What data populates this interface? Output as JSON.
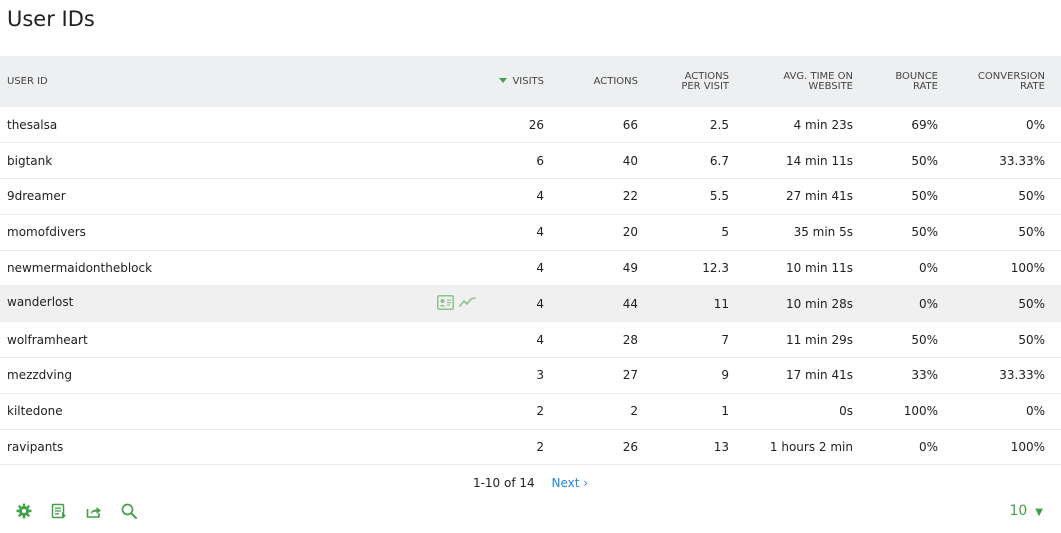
{
  "page": {
    "title": "User IDs"
  },
  "table": {
    "columns": {
      "user_id": "USER ID",
      "visits": "VISITS",
      "actions": "ACTIONS",
      "actions_per_visit_1": "ACTIONS",
      "actions_per_visit_2": "PER VISIT",
      "avg_time_1": "AVG. TIME ON",
      "avg_time_2": "WEBSITE",
      "bounce_1": "BOUNCE",
      "bounce_2": "RATE",
      "conversion_1": "CONVERSION",
      "conversion_2": "RATE"
    },
    "sorted_column": "visits",
    "rows": [
      {
        "user": "thesalsa",
        "visits": "26",
        "actions": "66",
        "apv": "2.5",
        "time": "4 min 23s",
        "bounce": "69%",
        "conv": "0%"
      },
      {
        "user": "bigtank",
        "visits": "6",
        "actions": "40",
        "apv": "6.7",
        "time": "14 min 11s",
        "bounce": "50%",
        "conv": "33.33%"
      },
      {
        "user": "9dreamer",
        "visits": "4",
        "actions": "22",
        "apv": "5.5",
        "time": "27 min 41s",
        "bounce": "50%",
        "conv": "50%"
      },
      {
        "user": "momofdivers",
        "visits": "4",
        "actions": "20",
        "apv": "5",
        "time": "35 min 5s",
        "bounce": "50%",
        "conv": "50%"
      },
      {
        "user": "newmermaidontheblock",
        "visits": "4",
        "actions": "49",
        "apv": "12.3",
        "time": "10 min 11s",
        "bounce": "0%",
        "conv": "100%"
      },
      {
        "user": "wanderlost",
        "visits": "4",
        "actions": "44",
        "apv": "11",
        "time": "10 min 28s",
        "bounce": "0%",
        "conv": "50%"
      },
      {
        "user": "wolframheart",
        "visits": "4",
        "actions": "28",
        "apv": "7",
        "time": "11 min 29s",
        "bounce": "50%",
        "conv": "50%"
      },
      {
        "user": "mezzdving",
        "visits": "3",
        "actions": "27",
        "apv": "9",
        "time": "17 min 41s",
        "bounce": "33%",
        "conv": "33.33%"
      },
      {
        "user": "kiltedone",
        "visits": "2",
        "actions": "2",
        "apv": "1",
        "time": "0s",
        "bounce": "100%",
        "conv": "0%"
      },
      {
        "user": "ravipants",
        "visits": "2",
        "actions": "26",
        "apv": "13",
        "time": "1 hours 2 min",
        "bounce": "0%",
        "conv": "100%"
      }
    ],
    "highlighted_row": 5,
    "row_icons": [
      "visitor-profile-icon",
      "row-evolution-icon"
    ]
  },
  "pagination": {
    "range": "1-10 of 14",
    "next": "Next ›"
  },
  "footer": {
    "icons": [
      "gear-icon",
      "export-table-icon",
      "export-icon",
      "search-icon"
    ],
    "limit": "10",
    "limit_caret": "▼"
  },
  "colors": {
    "accent": "#43a047",
    "link": "#1e88e5",
    "header_bg": "#eeeff0"
  }
}
